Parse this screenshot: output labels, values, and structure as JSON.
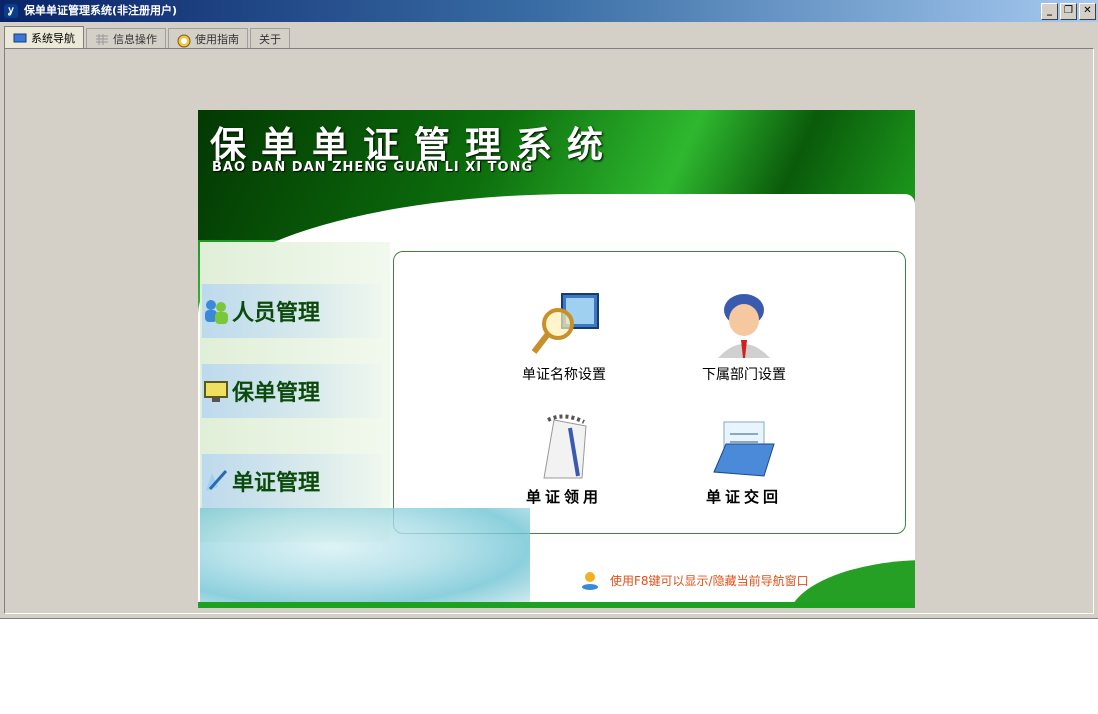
{
  "window": {
    "title": "保单单证管理系统(非注册用户)",
    "controls": {
      "minimize": "_",
      "restore": "❐",
      "close": "✕"
    }
  },
  "tabs": [
    {
      "label": "系统导航",
      "icon": "monitor-icon",
      "active": true
    },
    {
      "label": "信息操作",
      "icon": "grid-icon",
      "active": false
    },
    {
      "label": "使用指南",
      "icon": "help-icon",
      "active": false
    },
    {
      "label": "关于",
      "icon": "",
      "active": false
    }
  ],
  "nav": {
    "title": "保单单证管理系统",
    "subtitle": "BAO DAN DAN ZHENG GUAN LI XI TONG",
    "side_items": [
      {
        "label": "人员管理",
        "icon": "users-icon"
      },
      {
        "label": "保单管理",
        "icon": "monitor-icon"
      },
      {
        "label": "单证管理",
        "icon": "pen-icon"
      }
    ],
    "panel_items": [
      {
        "label": "单证名称设置",
        "icon": "magnifier-computer-icon"
      },
      {
        "label": "下属部门设置",
        "icon": "person-icon"
      },
      {
        "label": "单证领用",
        "icon": "notebook-icon"
      },
      {
        "label": "单证交回",
        "icon": "folder-document-icon"
      }
    ],
    "hint": "使用F8键可以显示/隐藏当前导航窗口"
  },
  "colors": {
    "title_bar": "#0a246a",
    "brand_green": "#1d9a1d",
    "hint_text": "#e0501a"
  }
}
